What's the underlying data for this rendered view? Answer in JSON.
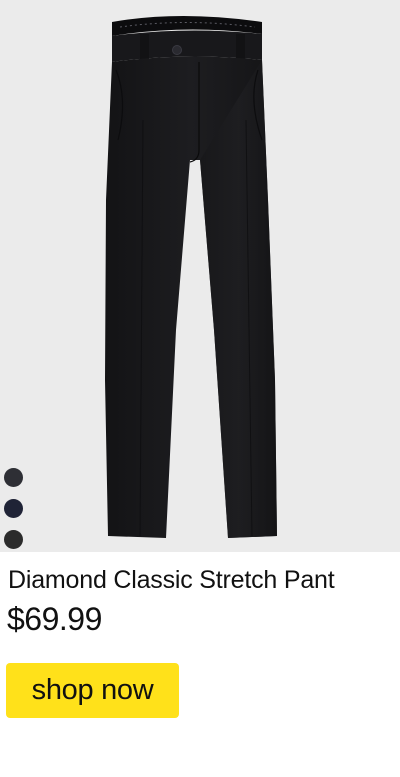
{
  "product": {
    "title": "Diamond Classic Stretch Pant",
    "price": "$69.99",
    "image_icon": "pants-image",
    "swatches": [
      {
        "color": "#2e2f35"
      },
      {
        "color": "#1f2336"
      },
      {
        "color": "#2b2b2b"
      }
    ]
  },
  "cta": {
    "label": "shop now",
    "color": "#ffe11a"
  }
}
